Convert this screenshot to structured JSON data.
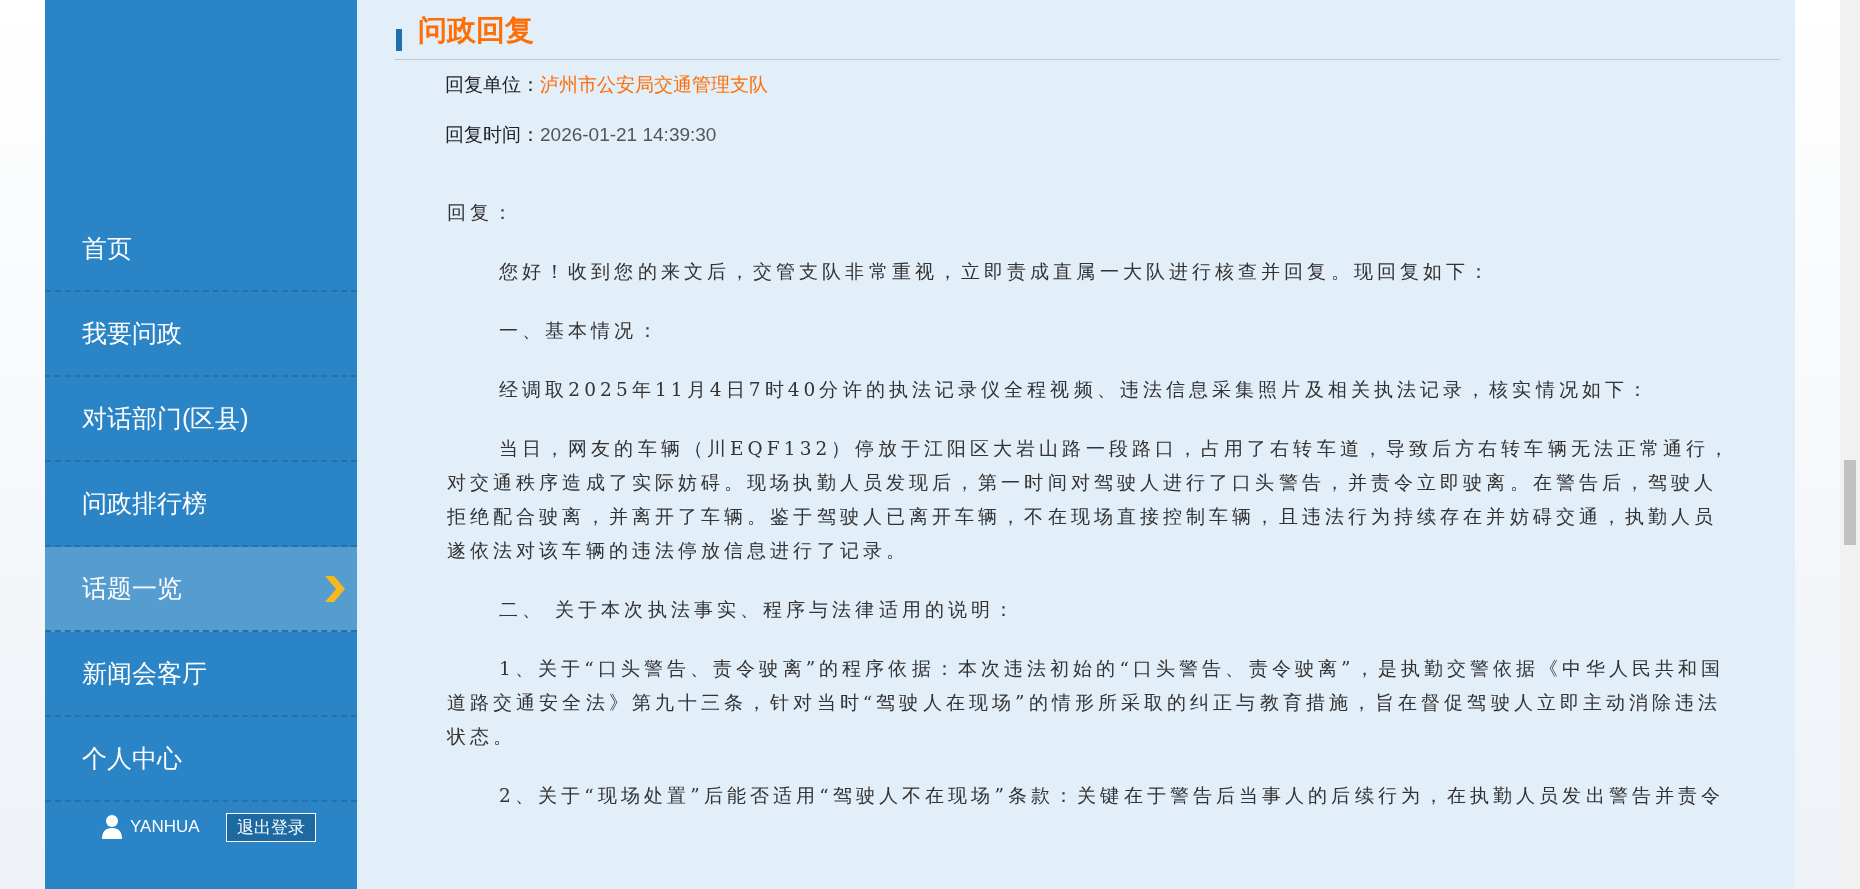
{
  "sidebar": {
    "items": [
      {
        "label": "首页",
        "selected": false
      },
      {
        "label": "我要问政",
        "selected": false
      },
      {
        "label": "对话部门(区县)",
        "selected": false
      },
      {
        "label": "问政排行榜",
        "selected": false
      },
      {
        "label": "话题一览",
        "selected": true
      },
      {
        "label": "新闻会客厅",
        "selected": false
      },
      {
        "label": "个人中心",
        "selected": false
      }
    ],
    "user": {
      "name": "YANHUA",
      "logout": "退出登录"
    }
  },
  "heading": "问政回复",
  "reply_info": [
    {
      "label": "回复单位：",
      "value": "泸州市公安局交通管理支队",
      "kind": "link"
    },
    {
      "label": "回复时间：",
      "value": "2026-01-21 14:39:30",
      "kind": "plain"
    }
  ],
  "body": [
    {
      "kind": "label",
      "text": "回复："
    },
    {
      "kind": "paragraph",
      "text": "您好！收到您的来文后，交管支队非常重视，立即责成直属一大队进行核查并回复。现回复如下："
    },
    {
      "kind": "paragraph",
      "text": "一、基本情况："
    },
    {
      "kind": "paragraph",
      "text": "经调取2025年11月4日7时40分许的执法记录仪全程视频、违法信息采集照片及相关执法记录，核实情况如下："
    },
    {
      "kind": "paragraph",
      "text": "当日，网友的车辆（川EQF132）停放于江阳区大岩山路一段路口，占用了右转车道，导致后方右转车辆无法正常通行，对交通秩序造成了实际妨碍。现场执勤人员发现后，第一时间对驾驶人进行了口头警告，并责令立即驶离。在警告后，驾驶人拒绝配合驶离，并离开了车辆。鉴于驾驶人已离开车辆，不在现场直接控制车辆，且违法行为持续存在并妨碍交通，执勤人员遂依法对该车辆的违法停放信息进行了记录。"
    },
    {
      "kind": "paragraph",
      "text": "二、 关于本次执法事实、程序与法律适用的说明："
    },
    {
      "kind": "paragraph",
      "text": "1、关于“口头警告、责令驶离”的程序依据：本次违法初始的“口头警告、责令驶离”，是执勤交警依据《中华人民共和国道路交通安全法》第九十三条，针对当时“驾驶人在现场”的情形所采取的纠正与教育措施，旨在督促驾驶人立即主动消除违法状态。"
    },
    {
      "kind": "paragraph",
      "text": "2、关于“现场处置”后能否适用“驾驶人不在现场”条款：关键在于警告后当事人的后续行为，在执勤人员发出警告并责令"
    }
  ]
}
